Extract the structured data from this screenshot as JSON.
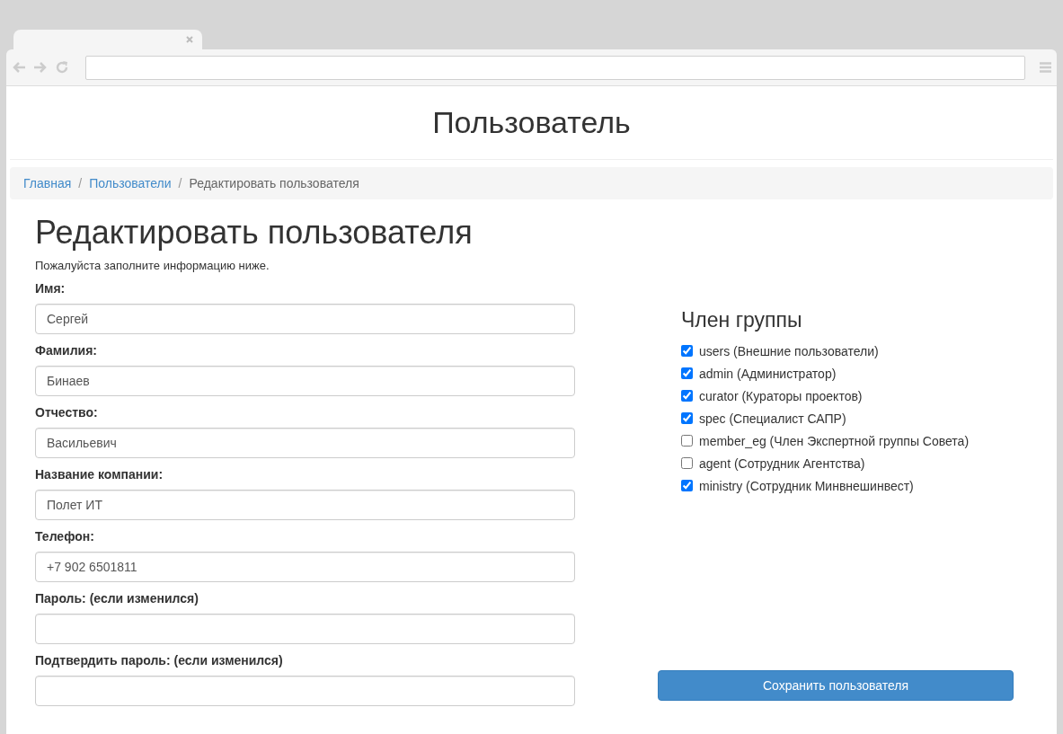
{
  "page": {
    "title": "Пользователь"
  },
  "breadcrumb_separator": "/",
  "breadcrumb": [
    {
      "label": "Главная",
      "kind": "link"
    },
    {
      "label": "Пользователи",
      "kind": "link"
    },
    {
      "label": "Редактировать пользователя",
      "kind": "current"
    }
  ],
  "form": {
    "heading": "Редактировать пользователя",
    "intro": "Пожалуйста заполните информацию ниже.",
    "fields": [
      {
        "label": "Имя:",
        "value": "Сергей"
      },
      {
        "label": "Фамилия:",
        "value": "Бинаев"
      },
      {
        "label": "Отчество:",
        "value": "Васильевич"
      },
      {
        "label": "Название компании:",
        "value": "Полет ИТ"
      },
      {
        "label": "Телефон:",
        "value": "+7 902 6501811"
      },
      {
        "label": "Пароль: (если изменился)"
      },
      {
        "label": "Подтвердить пароль: (если изменился)"
      }
    ]
  },
  "groups": {
    "heading": "Член группы",
    "items": [
      {
        "label": "users (Внешние пользователи)",
        "checked": true
      },
      {
        "label": "admin (Администратор)",
        "checked": true
      },
      {
        "label": "curator (Кураторы проектов)",
        "checked": true
      },
      {
        "label": "spec (Специалист САПР)",
        "checked": true
      },
      {
        "label": "member_eg (Член Экспертной группы Совета)",
        "checked": false
      },
      {
        "label": "agent (Сотрудник Агентства)",
        "checked": false
      },
      {
        "label": "ministry (Сотрудник Минвнешинвест)",
        "checked": true
      }
    ]
  },
  "save_button": "Сохранить пользователя"
}
